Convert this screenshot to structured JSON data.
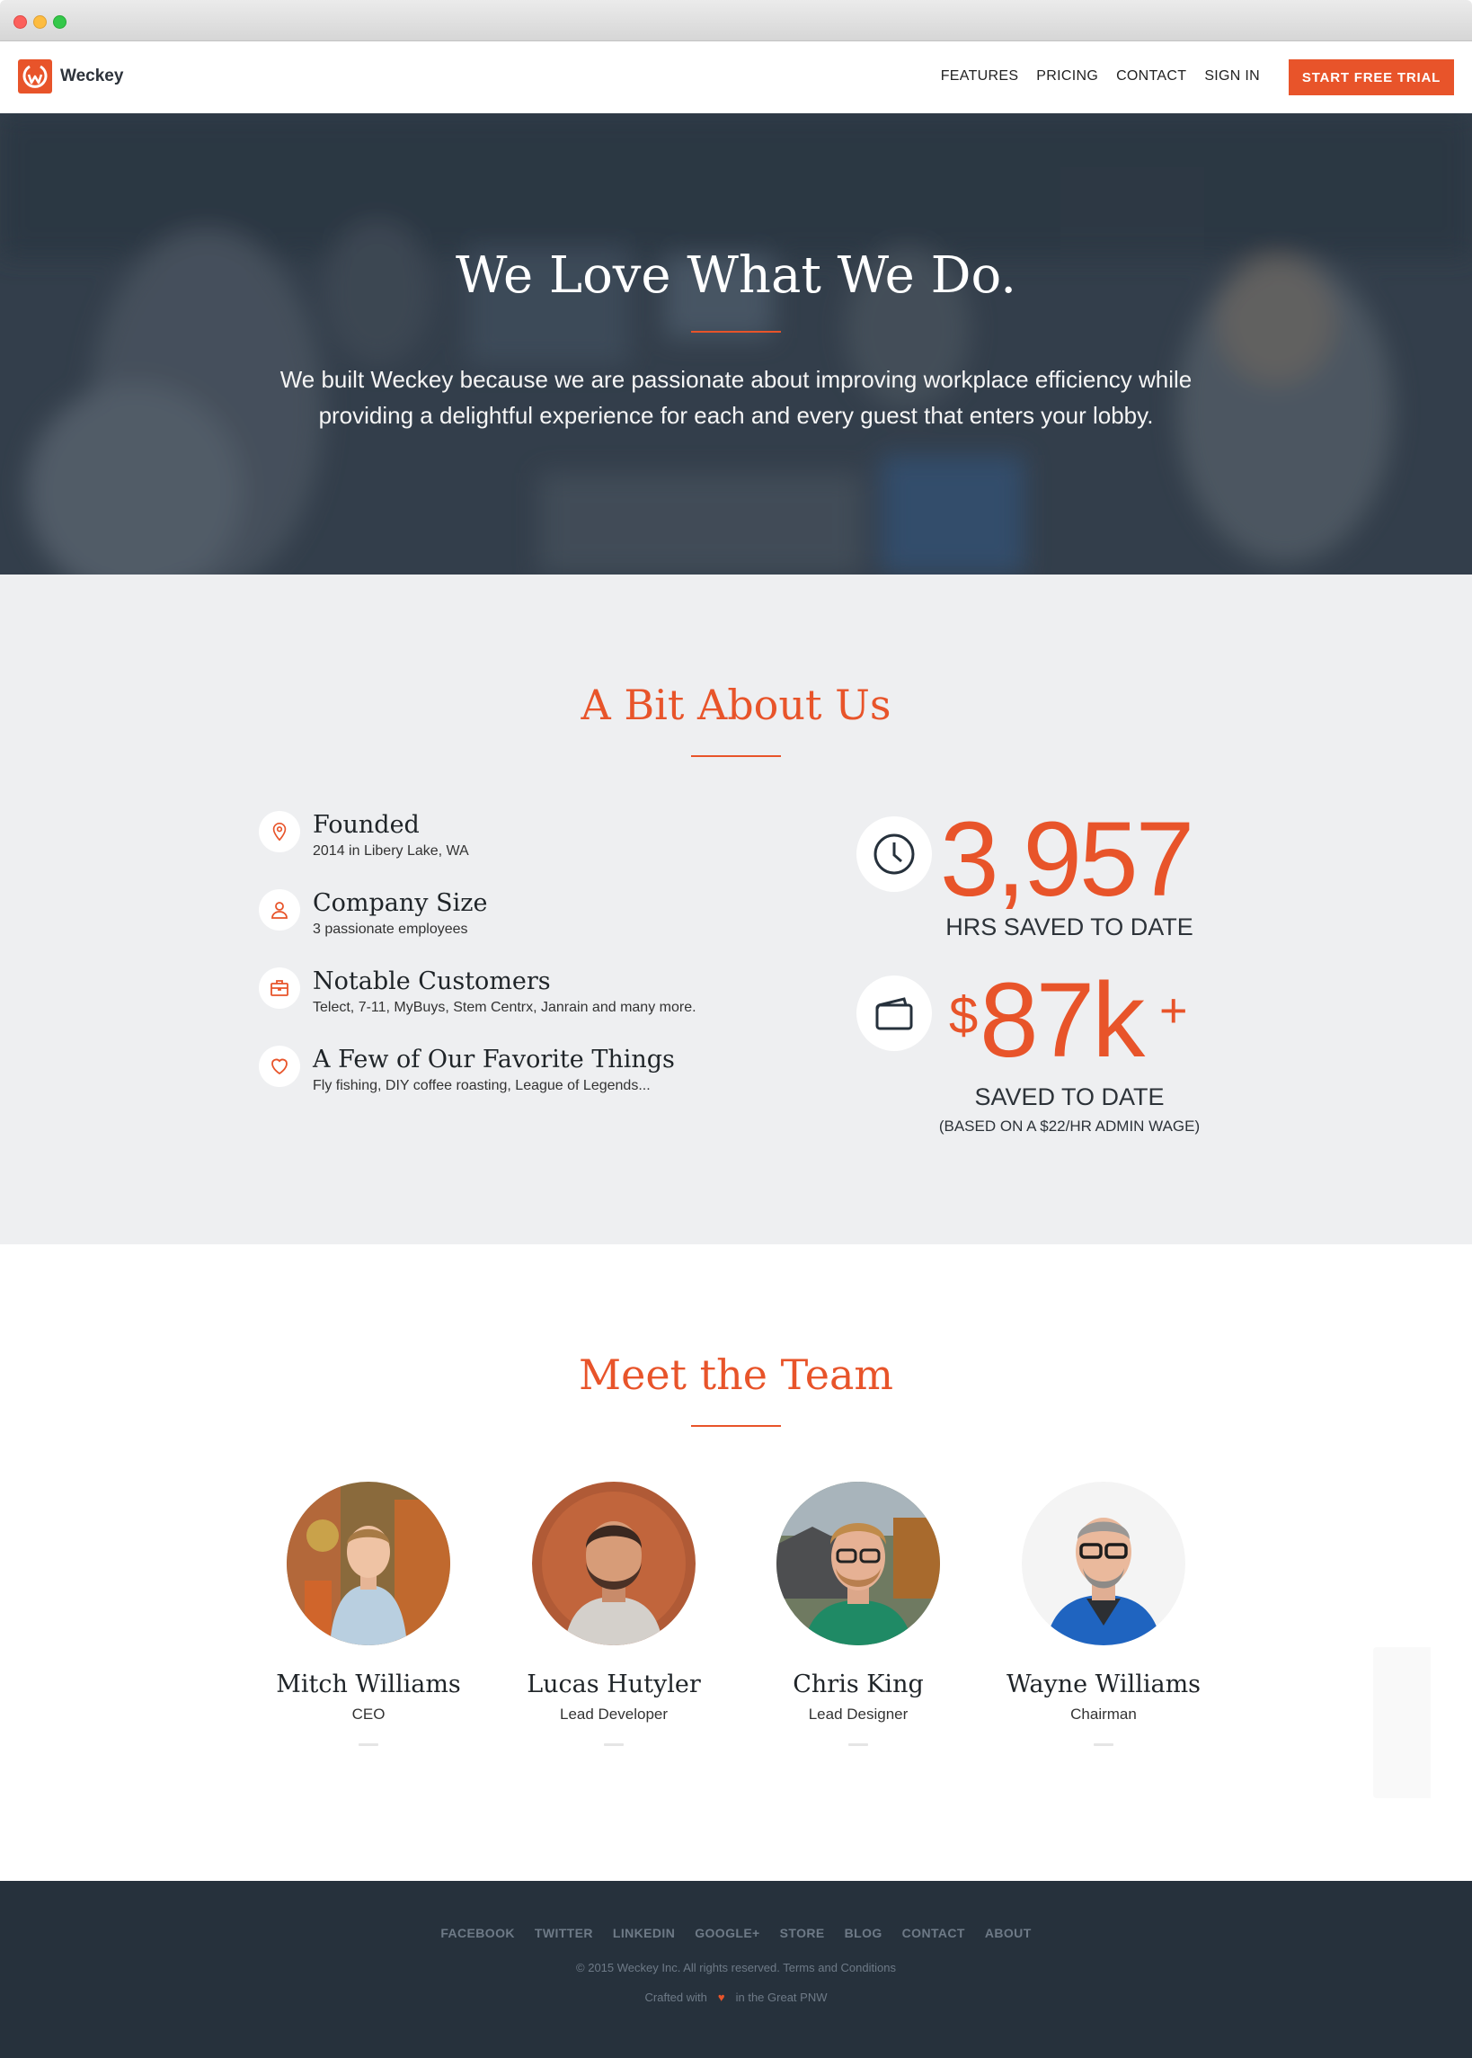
{
  "brand": {
    "name": "Weckey",
    "accent": "#e8542a",
    "dark": "#26313c"
  },
  "nav": {
    "links": [
      "FEATURES",
      "PRICING",
      "CONTACT",
      "SIGN IN"
    ],
    "cta": "START FREE TRIAL"
  },
  "hero": {
    "title": "We Love What We Do.",
    "text": "We built Weckey because we are passionate about improving workplace efficiency while providing a delightful experience for each and every guest that enters your lobby."
  },
  "about": {
    "title": "A Bit About Us",
    "facts": [
      {
        "icon": "map-pin-icon",
        "title": "Founded",
        "desc": "2014 in Libery Lake, WA"
      },
      {
        "icon": "user-icon",
        "title": "Company Size",
        "desc": "3 passionate employees"
      },
      {
        "icon": "briefcase-icon",
        "title": "Notable Customers",
        "desc": "Telect, 7-11, MyBuys, Stem Centrx, Janrain and many more."
      },
      {
        "icon": "heart-icon",
        "title": "A Few of Our Favorite Things",
        "desc": "Fly fishing, DIY coffee roasting, League of Legends..."
      }
    ],
    "stats": {
      "hours": {
        "icon": "clock-icon",
        "value": "3,957",
        "label": "HRS SAVED TO DATE"
      },
      "money": {
        "icon": "wallet-icon",
        "currency": "$",
        "value": "87k",
        "suffix": "+",
        "label": "SAVED TO DATE",
        "note": "(BASED ON A $22/HR ADMIN WAGE)"
      }
    }
  },
  "team": {
    "title": "Meet the Team",
    "members": [
      {
        "name": "Mitch Williams",
        "role": "CEO"
      },
      {
        "name": "Lucas Hutyler",
        "role": "Lead Developer"
      },
      {
        "name": "Chris King",
        "role": "Lead Designer"
      },
      {
        "name": "Wayne Williams",
        "role": "Chairman"
      }
    ]
  },
  "footer": {
    "links": [
      "FACEBOOK",
      "TWITTER",
      "LINKEDIN",
      "GOOGLE+",
      "STORE",
      "BLOG",
      "CONTACT",
      "ABOUT"
    ],
    "copyright": "© 2015 Weckey Inc. All rights reserved. Terms and Conditions",
    "crafted_prefix": "Crafted with",
    "crafted_suffix": "in the Great PNW"
  }
}
